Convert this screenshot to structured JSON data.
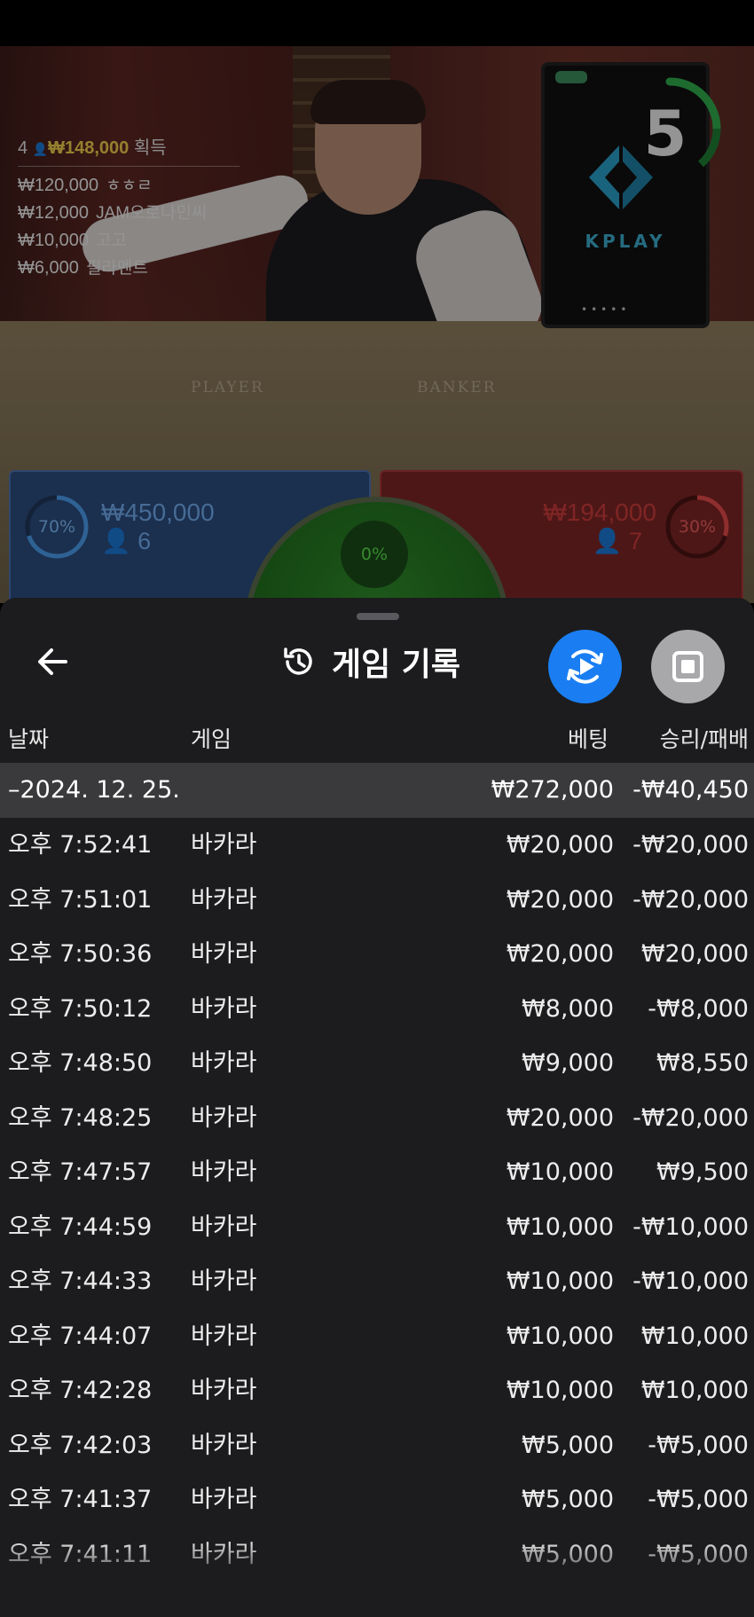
{
  "live": {
    "winners": {
      "count": "4",
      "total": "₩148,000",
      "suffix": "획득",
      "list": [
        {
          "amount": "₩120,000",
          "name": "ㅎㅎㄹ"
        },
        {
          "amount": "₩12,000",
          "name": "JAM오로나민씨"
        },
        {
          "amount": "₩10,000",
          "name": "고고"
        },
        {
          "amount": "₩6,000",
          "name": "필라멘트"
        }
      ]
    },
    "timer": "5",
    "table_labels": {
      "player": "PLAYER",
      "banker": "BANKER"
    },
    "kplay": "KPLAY",
    "player": {
      "percent": "70%",
      "amount": "₩450,000",
      "count": "6",
      "color": "#2b4a7a"
    },
    "banker": {
      "percent": "30%",
      "amount": "₩194,000",
      "count": "7",
      "color": "#7a2424"
    },
    "tie": {
      "percent": "0%",
      "color": "#2f8a2a"
    }
  },
  "history": {
    "title": "게임 기록",
    "columns": {
      "date": "날짜",
      "game": "게임",
      "bet": "베팅",
      "result": "승리/패배"
    },
    "date_group": {
      "date": "–2024. 12. 25.",
      "bet": "₩272,000",
      "result": "-₩40,450"
    },
    "rows": [
      {
        "time": "오후 7:52:41",
        "game": "바카라",
        "bet": "₩20,000",
        "result": "-₩20,000"
      },
      {
        "time": "오후 7:51:01",
        "game": "바카라",
        "bet": "₩20,000",
        "result": "-₩20,000"
      },
      {
        "time": "오후 7:50:36",
        "game": "바카라",
        "bet": "₩20,000",
        "result": "₩20,000"
      },
      {
        "time": "오후 7:50:12",
        "game": "바카라",
        "bet": "₩8,000",
        "result": "-₩8,000"
      },
      {
        "time": "오후 7:48:50",
        "game": "바카라",
        "bet": "₩9,000",
        "result": "₩8,550"
      },
      {
        "time": "오후 7:48:25",
        "game": "바카라",
        "bet": "₩20,000",
        "result": "-₩20,000"
      },
      {
        "time": "오후 7:47:57",
        "game": "바카라",
        "bet": "₩10,000",
        "result": "₩9,500"
      },
      {
        "time": "오후 7:44:59",
        "game": "바카라",
        "bet": "₩10,000",
        "result": "-₩10,000"
      },
      {
        "time": "오후 7:44:33",
        "game": "바카라",
        "bet": "₩10,000",
        "result": "-₩10,000"
      },
      {
        "time": "오후 7:44:07",
        "game": "바카라",
        "bet": "₩10,000",
        "result": "₩10,000"
      },
      {
        "time": "오후 7:42:28",
        "game": "바카라",
        "bet": "₩10,000",
        "result": "₩10,000"
      },
      {
        "time": "오후 7:42:03",
        "game": "바카라",
        "bet": "₩5,000",
        "result": "-₩5,000"
      },
      {
        "time": "오후 7:41:37",
        "game": "바카라",
        "bet": "₩5,000",
        "result": "-₩5,000"
      },
      {
        "time": "오후 7:41:11",
        "game": "바카라",
        "bet": "₩5,000",
        "result": "-₩5,000"
      }
    ]
  },
  "icons": {
    "back": "arrow-left-icon",
    "history": "history-icon",
    "replay": "replay-icon",
    "stop": "stop-icon"
  },
  "colors": {
    "accent_blue": "#1a7ef2",
    "sheet_bg": "#1c1c1e",
    "date_row_bg": "#3a3a3c",
    "winner_gold": "#e9c84a"
  }
}
